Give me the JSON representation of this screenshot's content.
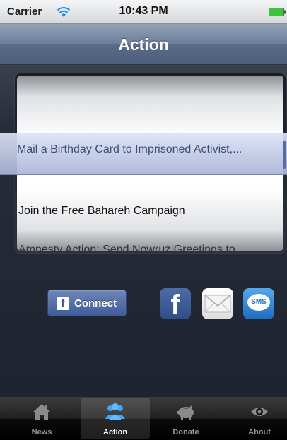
{
  "status_bar": {
    "carrier": "Carrier",
    "time": "10:43 PM"
  },
  "nav": {
    "title": "Action"
  },
  "picker": {
    "selected": "Mail a Birthday Card to Imprisoned Activist,...",
    "rows": [
      "Join the Free Bahareh Campaign",
      "Amnesty Action: Send Nowruz Greetings to..."
    ]
  },
  "share": {
    "connect_label": "Connect",
    "facebook_glyph": "f",
    "sms_label": "SMS"
  },
  "tabs": [
    {
      "label": "News",
      "icon": "home-icon"
    },
    {
      "label": "Action",
      "icon": "people-icon"
    },
    {
      "label": "Donate",
      "icon": "piggy-bank-icon"
    },
    {
      "label": "About",
      "icon": "eye-icon"
    }
  ],
  "colors": {
    "nav_bar": "#6b7d99",
    "background": "#1f2633",
    "selection": "#c7cfe8",
    "facebook": "#3b5998",
    "active_tab_icon": "#4fb0ff",
    "battery": "#40c040"
  }
}
